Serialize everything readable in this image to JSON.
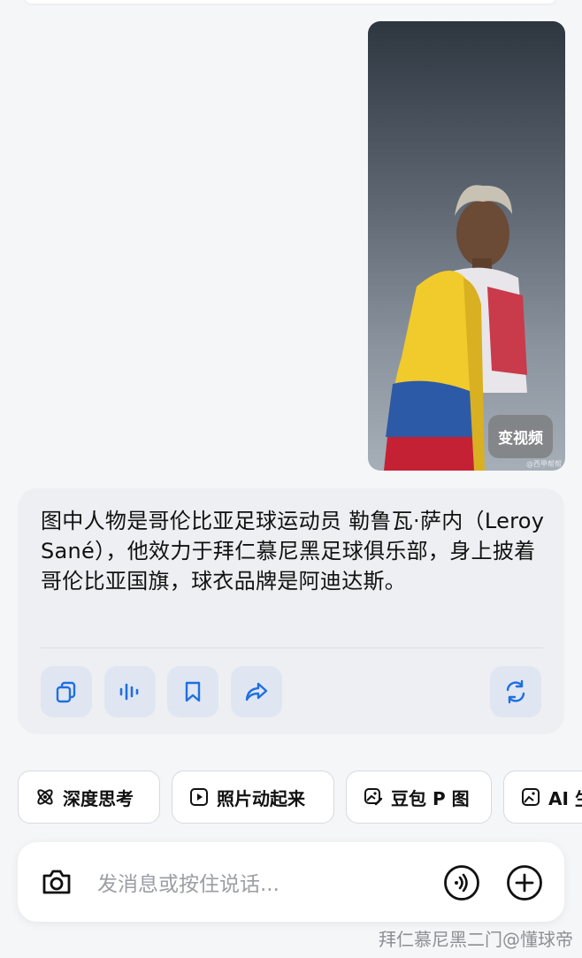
{
  "photo": {
    "to_video_label": "变视频",
    "source_mark": "@西甲帮帮",
    "description_icon": "player-with-flag-photo"
  },
  "answer": {
    "text": "图中人物是哥伦比亚足球运动员 勒鲁瓦·萨内（Leroy Sané），他效力于拜仁慕尼黑足球俱乐部，身上披着哥伦比亚国旗，球衣品牌是阿迪达斯。",
    "actions": [
      "copy-icon",
      "voice-wave-icon",
      "bookmark-icon",
      "share-icon",
      "regenerate-icon"
    ]
  },
  "chips": [
    {
      "label": "深度思考",
      "icon": "atom-icon"
    },
    {
      "label": "照片动起来",
      "icon": "play-square-icon"
    },
    {
      "label": "豆包 P 图",
      "icon": "image-edit-icon"
    },
    {
      "label": "AI 生",
      "icon": "image-icon"
    }
  ],
  "input": {
    "placeholder": "发消息或按住说话..."
  },
  "watermark": "拜仁慕尼黑二门@懂球帝",
  "colors": {
    "accent": "#1f6fe0",
    "action_bg": "#dfe6f2",
    "card_bg": "#eeeff2"
  }
}
